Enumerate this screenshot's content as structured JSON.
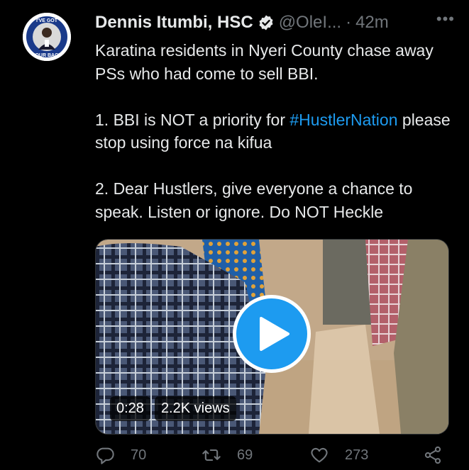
{
  "tweet": {
    "author_name": "Dennis Itumbi, HSC",
    "handle": "@OleI...",
    "separator": "·",
    "time": "42m",
    "more": "•••",
    "avatar_text_top": "I'VE GOT",
    "avatar_text_bottom": "YOUR BACK",
    "text_line1": "Karatina residents in Nyeri County chase away PSs who had come to sell BBI.",
    "text_line2_prefix": "1. BBI is NOT a priority for ",
    "text_line2_hashtag": "#HustlerNation",
    "text_line2_suffix": " please stop using force na kifua",
    "text_line3": "2. Dear Hustlers, give everyone a chance to speak. Listen or ignore. Do NOT Heckle"
  },
  "media": {
    "duration": "0:28",
    "views": "2.2K views"
  },
  "actions": {
    "replies": "70",
    "retweets": "69",
    "likes": "273"
  },
  "colors": {
    "accent": "#1d9bf0",
    "muted": "#71767b",
    "text": "#e7e9ea",
    "background": "#000000"
  },
  "icons": [
    "verified-badge-icon",
    "more-icon",
    "play-icon",
    "reply-icon",
    "retweet-icon",
    "like-icon",
    "share-icon"
  ]
}
